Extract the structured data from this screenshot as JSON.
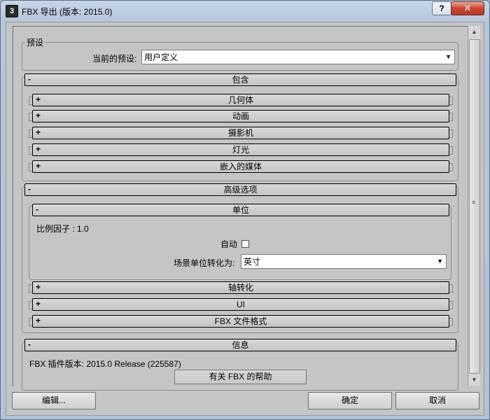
{
  "window": {
    "title": "FBX 导出 (版本: 2015.0)",
    "app_icon": "3dsmax-icon",
    "help_label": "?",
    "close_label": "✕"
  },
  "preset": {
    "group_label": "预设",
    "current_label": "当前的预设:",
    "current_value": "用户定义"
  },
  "include": {
    "sign": "-",
    "title": "包含",
    "items": [
      {
        "sign": "+",
        "title": "几何体"
      },
      {
        "sign": "+",
        "title": "动画"
      },
      {
        "sign": "+",
        "title": "摄影机"
      },
      {
        "sign": "+",
        "title": "灯光"
      },
      {
        "sign": "+",
        "title": "嵌入的媒体"
      }
    ]
  },
  "advanced": {
    "sign": "-",
    "title": "高级选项",
    "units": {
      "sign": "-",
      "title": "单位",
      "scale_factor_label": "比例因子 : 1.0",
      "auto_label": "自动",
      "auto_checked": false,
      "convert_label": "场景单位转化为:",
      "convert_value": "英寸"
    },
    "items": [
      {
        "sign": "+",
        "title": "轴转化"
      },
      {
        "sign": "+",
        "title": "UI"
      },
      {
        "sign": "+",
        "title": "FBX 文件格式"
      }
    ]
  },
  "info": {
    "sign": "-",
    "title": "信息",
    "plugin_version": "FBX 插件版本: 2015.0 Release (225587)",
    "help_button": "有关 FBX 的帮助"
  },
  "footer": {
    "edit_button": "编辑...",
    "ok_button": "确定",
    "cancel_button": "取消"
  }
}
